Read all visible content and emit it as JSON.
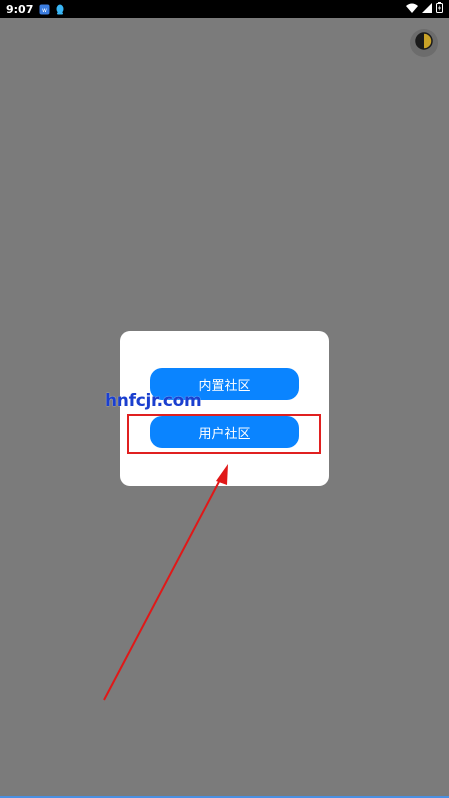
{
  "status_bar": {
    "time": "9:07",
    "left_icons": [
      "app-notification-icon",
      "qq-icon"
    ],
    "right_icons": [
      "wifi-icon",
      "signal-icon",
      "battery-icon"
    ]
  },
  "dialog": {
    "buttons": [
      {
        "label": "内置社区"
      },
      {
        "label": "用户社区"
      }
    ]
  },
  "watermark": {
    "text": "hnfcjr.com"
  },
  "colors": {
    "background": "#7b7b7b",
    "button": "#0a84ff",
    "highlight": "#e02020",
    "watermark": "#1a3fcf"
  },
  "theme_toggle_icon": "half-moon-contrast-icon"
}
